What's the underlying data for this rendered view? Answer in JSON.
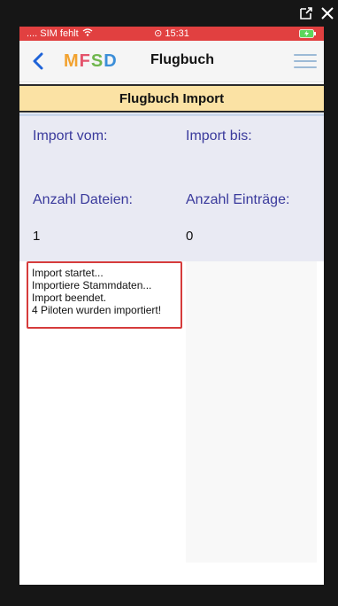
{
  "overlay": {
    "open_external_icon": "external-link-icon",
    "close_icon": "close-icon"
  },
  "status_bar": {
    "carrier": ".... SIM fehlt",
    "time": "⊙ 15:31",
    "battery_icon": "battery-charging-icon",
    "color": "#e14040"
  },
  "nav": {
    "back_icon": "chevron-left-icon",
    "logo": "MFSD",
    "title": "Flugbuch",
    "menu_icon": "menu-icon"
  },
  "section": {
    "title": "Flugbuch Import",
    "header_color": "#fbe2a4"
  },
  "import": {
    "from_label": "Import vom:",
    "to_label": "Import bis:",
    "files_label": "Anzahl Dateien:",
    "entries_label": "Anzahl Einträge:",
    "files_value": "1",
    "entries_value": "0",
    "label_color": "#3a3a9c"
  },
  "log": {
    "lines": [
      "Import startet...",
      "Importiere Stammdaten...",
      "Import beendet.",
      "4 Piloten wurden importiert!"
    ],
    "highlight_color": "#d63c3c"
  }
}
